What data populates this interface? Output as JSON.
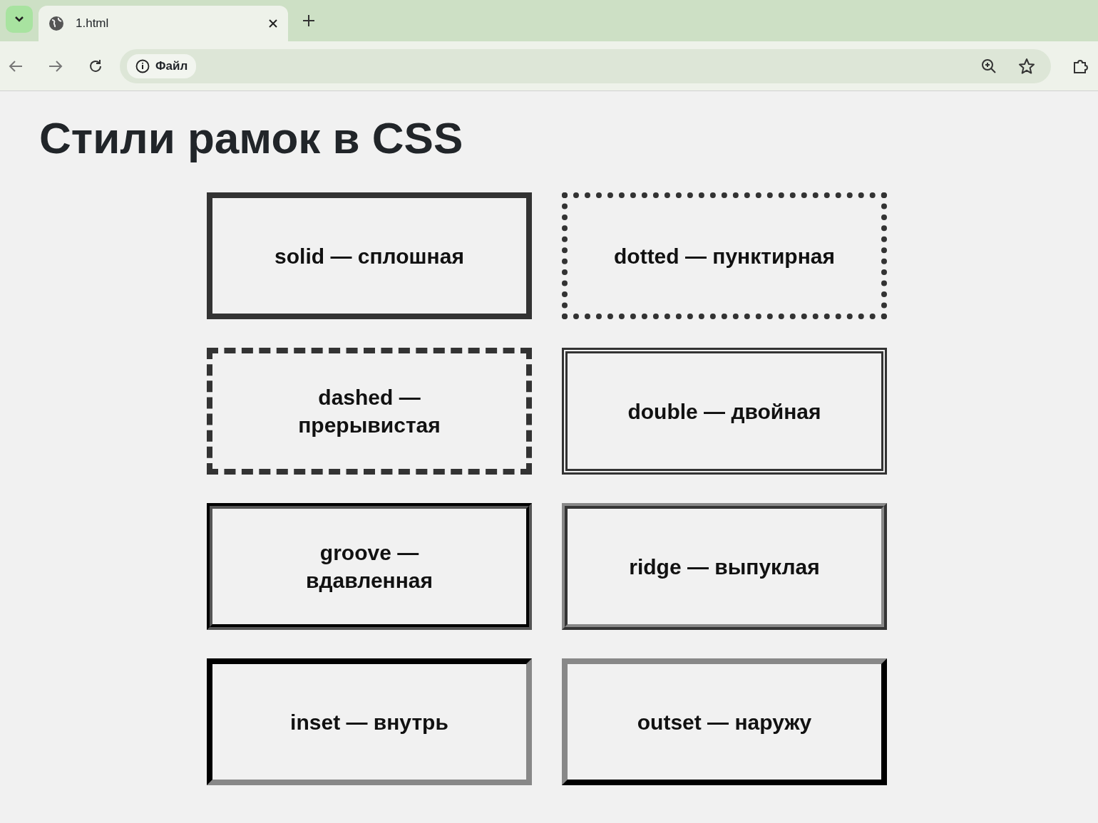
{
  "browser": {
    "tab_title": "1.html",
    "address_chip": "Файл"
  },
  "heading": "Стили рамок в CSS",
  "boxes": [
    {
      "kind": "solid",
      "lines": [
        "solid — сплошная"
      ]
    },
    {
      "kind": "dotted",
      "lines": [
        "dotted — пунктирная"
      ]
    },
    {
      "kind": "dashed",
      "lines": [
        "dashed —",
        "прерывистая"
      ]
    },
    {
      "kind": "double",
      "lines": [
        "double — двойная"
      ]
    },
    {
      "kind": "groove",
      "lines": [
        "groove —",
        "вдавленная"
      ]
    },
    {
      "kind": "ridge",
      "lines": [
        "ridge — выпуклая"
      ]
    },
    {
      "kind": "inset",
      "lines": [
        "inset — внутрь"
      ]
    },
    {
      "kind": "outset",
      "lines": [
        "outset — наружу"
      ]
    }
  ]
}
